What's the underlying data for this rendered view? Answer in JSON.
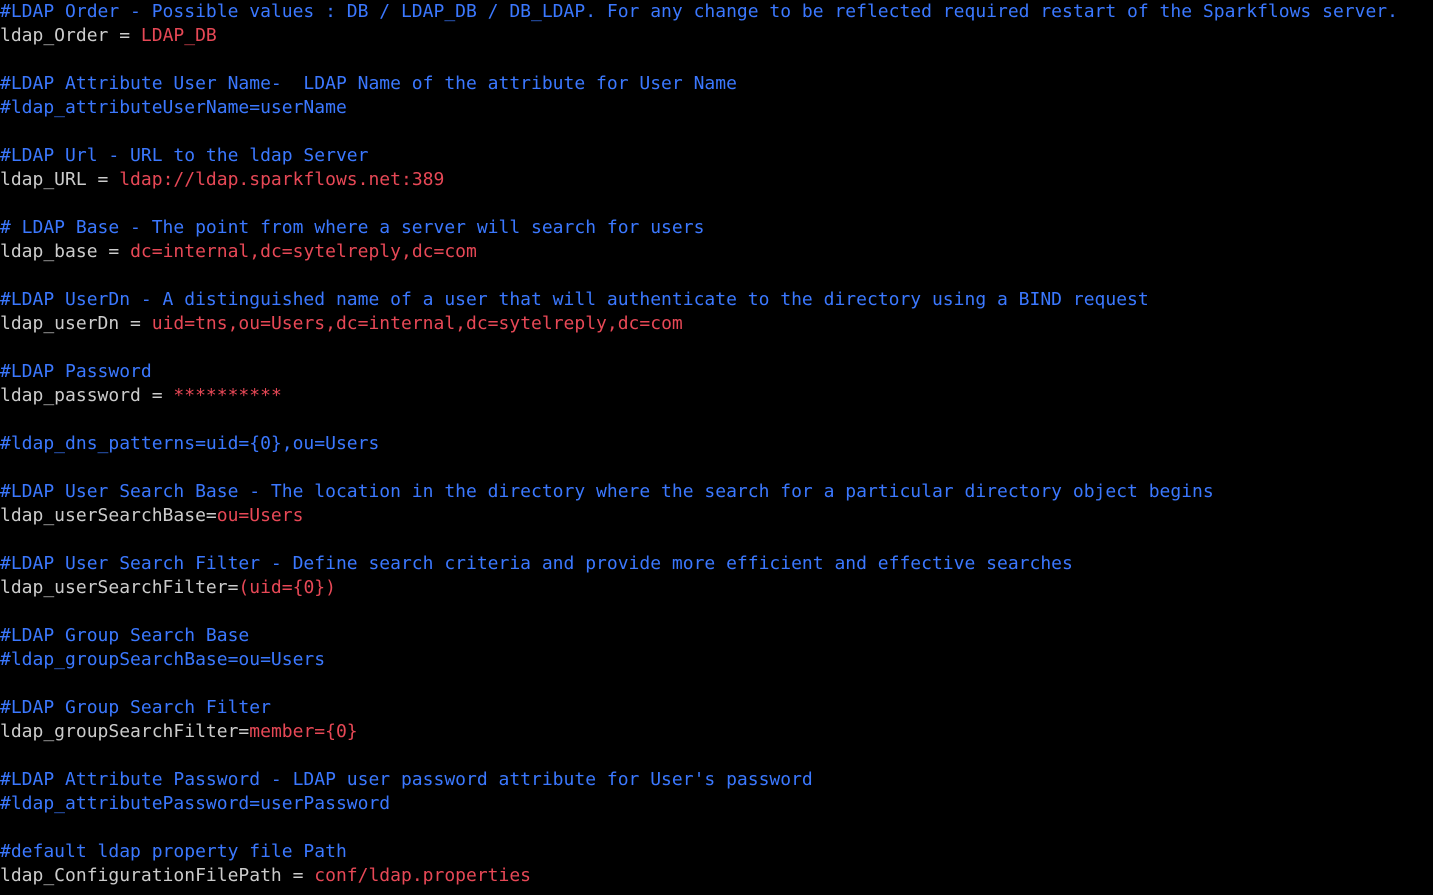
{
  "colors": {
    "background": "#000000",
    "comment": "#3b78ff",
    "key": "#cccccc",
    "value": "#e74856"
  },
  "lines": [
    {
      "kind": "comment",
      "text": "#LDAP Order - Possible values : DB / LDAP_DB / DB_LDAP. For any change to be reflected required restart of the Sparkflows server."
    },
    {
      "kind": "prop",
      "key": "ldap_Order",
      "eq": " = ",
      "value": "LDAP_DB"
    },
    {
      "kind": "blank"
    },
    {
      "kind": "comment",
      "text": "#LDAP Attribute User Name-  LDAP Name of the attribute for User Name"
    },
    {
      "kind": "comment",
      "text": "#ldap_attributeUserName=userName"
    },
    {
      "kind": "blank"
    },
    {
      "kind": "comment",
      "text": "#LDAP Url - URL to the ldap Server"
    },
    {
      "kind": "prop",
      "key": "ldap_URL",
      "eq": " = ",
      "value": "ldap://ldap.sparkflows.net:389"
    },
    {
      "kind": "blank"
    },
    {
      "kind": "comment",
      "text": "# LDAP Base - The point from where a server will search for users"
    },
    {
      "kind": "prop",
      "key": "ldap_base",
      "eq": " = ",
      "value": "dc=internal,dc=sytelreply,dc=com"
    },
    {
      "kind": "blank"
    },
    {
      "kind": "comment",
      "text": "#LDAP UserDn - A distinguished name of a user that will authenticate to the directory using a BIND request"
    },
    {
      "kind": "prop",
      "key": "ldap_userDn",
      "eq": " = ",
      "value": "uid=tns,ou=Users,dc=internal,dc=sytelreply,dc=com"
    },
    {
      "kind": "blank"
    },
    {
      "kind": "comment",
      "text": "#LDAP Password"
    },
    {
      "kind": "prop",
      "key": "ldap_password",
      "eq": " = ",
      "value": "**********"
    },
    {
      "kind": "blank"
    },
    {
      "kind": "comment",
      "text": "#ldap_dns_patterns=uid={0},ou=Users"
    },
    {
      "kind": "blank"
    },
    {
      "kind": "comment",
      "text": "#LDAP User Search Base - The location in the directory where the search for a particular directory object begins"
    },
    {
      "kind": "prop",
      "key": "ldap_userSearchBase",
      "eq": "=",
      "value": "ou=Users"
    },
    {
      "kind": "blank"
    },
    {
      "kind": "comment",
      "text": "#LDAP User Search Filter - Define search criteria and provide more efficient and effective searches"
    },
    {
      "kind": "prop",
      "key": "ldap_userSearchFilter",
      "eq": "=",
      "value": "(uid={0})"
    },
    {
      "kind": "blank"
    },
    {
      "kind": "comment",
      "text": "#LDAP Group Search Base"
    },
    {
      "kind": "comment",
      "text": "#ldap_groupSearchBase=ou=Users"
    },
    {
      "kind": "blank"
    },
    {
      "kind": "comment",
      "text": "#LDAP Group Search Filter"
    },
    {
      "kind": "prop",
      "key": "ldap_groupSearchFilter",
      "eq": "=",
      "value": "member={0}"
    },
    {
      "kind": "blank"
    },
    {
      "kind": "comment",
      "text": "#LDAP Attribute Password - LDAP user password attribute for User's password"
    },
    {
      "kind": "comment",
      "text": "#ldap_attributePassword=userPassword"
    },
    {
      "kind": "blank"
    },
    {
      "kind": "comment",
      "text": "#default ldap property file Path"
    },
    {
      "kind": "prop",
      "key": "ldap_ConfigurationFilePath",
      "eq": " = ",
      "value": "conf/ldap.properties"
    }
  ]
}
